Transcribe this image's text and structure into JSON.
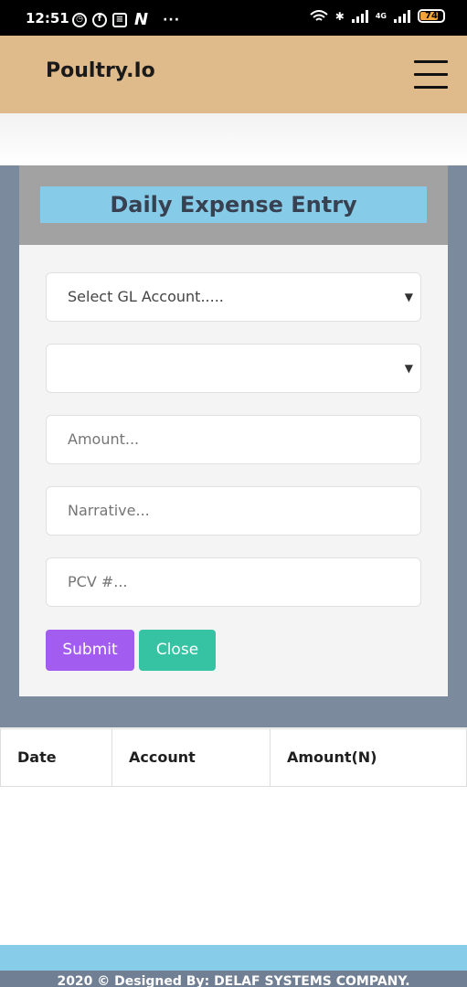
{
  "status_bar": {
    "time": "12:51",
    "network": "4G",
    "battery": "74"
  },
  "navbar": {
    "brand": "Poultry.Io"
  },
  "form": {
    "title": "Daily Expense Entry",
    "gl_account_select": "Select GL Account.....",
    "second_select": "",
    "amount_placeholder": "Amount...",
    "narrative_placeholder": "Narrative...",
    "pcv_placeholder": "PCV #...",
    "submit_label": "Submit",
    "close_label": "Close"
  },
  "table": {
    "headers": [
      "Date",
      "Account",
      "Amount(N)"
    ]
  },
  "footer": {
    "text": "2020 © Designed By: DELAF SYSTEMS COMPANY."
  },
  "colors": {
    "navbar": "#dfba8b",
    "section_bg": "#7b8a9d",
    "title_bg": "#86cce9",
    "submit": "#a25df0",
    "close": "#36c3a3"
  }
}
